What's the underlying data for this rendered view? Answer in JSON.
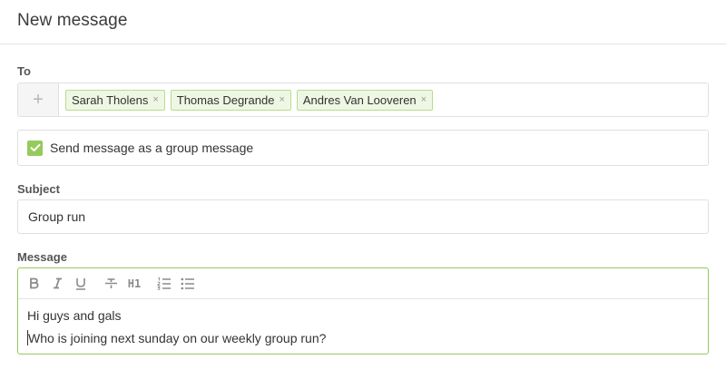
{
  "header": {
    "title": "New message"
  },
  "to": {
    "label": "To",
    "add_symbol": "+",
    "recipients": [
      {
        "name": "Sarah Tholens"
      },
      {
        "name": "Thomas Degrande"
      },
      {
        "name": "Andres Van Looveren"
      }
    ],
    "remove_symbol": "×"
  },
  "group_message": {
    "label": "Send message as a group message",
    "checked": true
  },
  "subject": {
    "label": "Subject",
    "value": "Group run"
  },
  "message": {
    "label": "Message",
    "toolbar": {
      "h1_label": "H1"
    },
    "lines": [
      "Hi guys and gals",
      "Who is joining next sunday on our weekly group run?"
    ]
  },
  "colors": {
    "accent": "#97c95c",
    "chip_bg": "#eef7e3",
    "chip_border": "#b9dc8f"
  }
}
